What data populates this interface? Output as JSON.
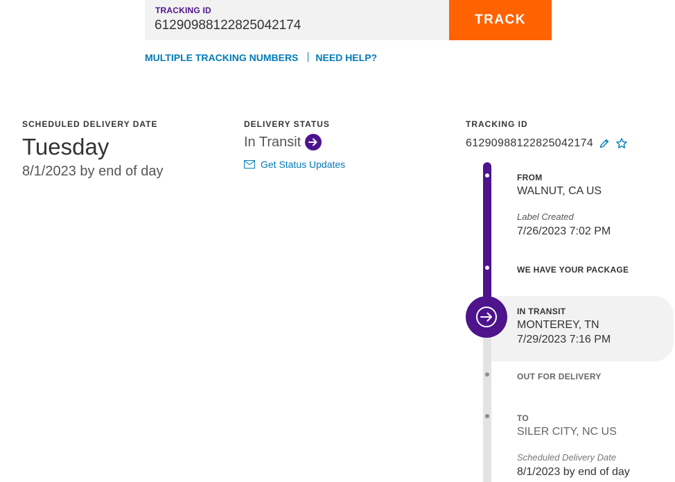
{
  "search": {
    "label": "TRACKING ID",
    "value": "61290988122825042174",
    "button_label": "TRACK"
  },
  "links": {
    "multiple": "MULTIPLE TRACKING NUMBERS",
    "help": "NEED HELP?"
  },
  "delivery": {
    "heading": "SCHEDULED DELIVERY DATE",
    "day": "Tuesday",
    "date": "8/1/2023 by end of day"
  },
  "status": {
    "heading": "DELIVERY STATUS",
    "text": "In Transit",
    "updates_link": "Get Status Updates"
  },
  "tracking": {
    "heading": "TRACKING ID",
    "number": "61290988122825042174"
  },
  "timeline": {
    "from_heading": "FROM",
    "from_location": "WALNUT, CA US",
    "label_created": "Label Created",
    "label_created_time": "7/26/2023 7:02 PM",
    "have_package": "WE HAVE YOUR PACKAGE",
    "in_transit_heading": "IN TRANSIT",
    "in_transit_location": "MONTEREY, TN",
    "in_transit_time": "7/29/2023 7:16 PM",
    "out_for_delivery": "OUT FOR DELIVERY",
    "to_heading": "TO",
    "to_location": "SILER CITY, NC US",
    "scheduled_note": "Scheduled Delivery Date",
    "scheduled_date": "8/1/2023 by end of day"
  },
  "colors": {
    "brand_purple": "#4d148c",
    "brand_orange": "#ff6200",
    "link_blue": "#007ab7"
  }
}
